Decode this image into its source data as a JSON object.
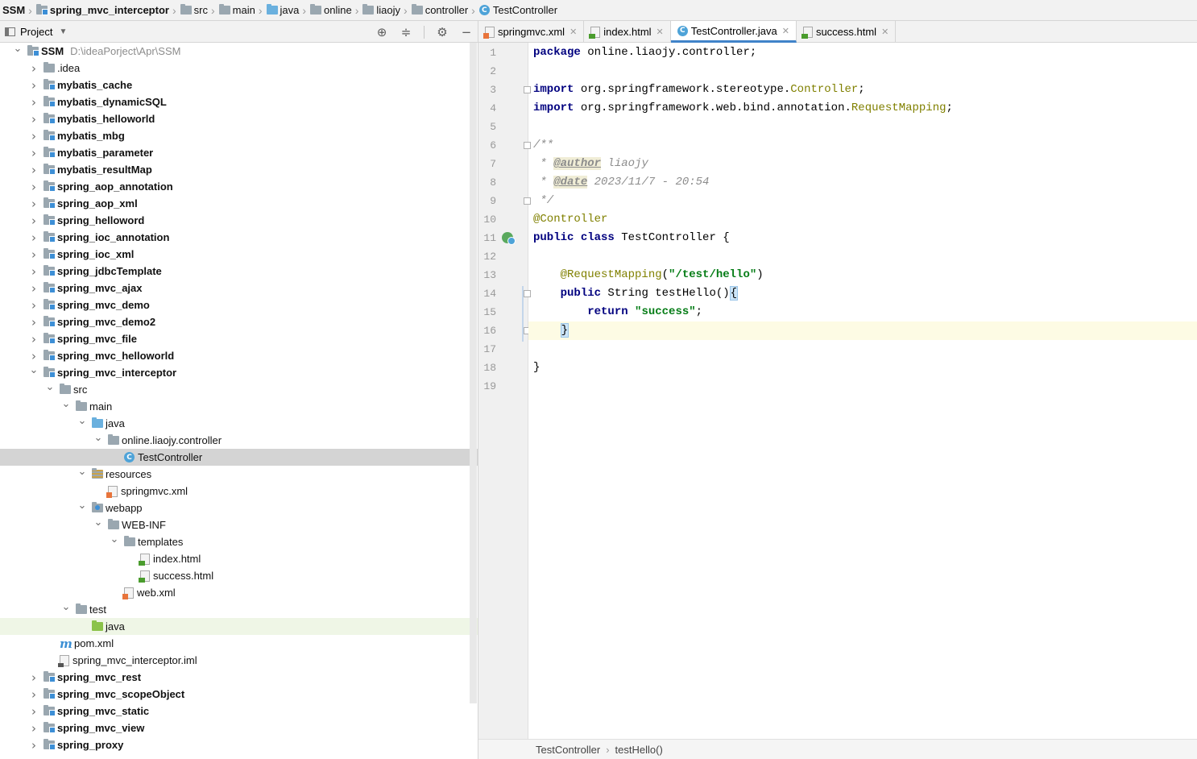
{
  "breadcrumbs": [
    {
      "label": "SSM",
      "icon": "none",
      "bold": true
    },
    {
      "label": "spring_mvc_interceptor",
      "icon": "module-folder",
      "bold": true
    },
    {
      "label": "src",
      "icon": "folder",
      "bold": false
    },
    {
      "label": "main",
      "icon": "folder",
      "bold": false
    },
    {
      "label": "java",
      "icon": "source-folder",
      "bold": false
    },
    {
      "label": "online",
      "icon": "package",
      "bold": false
    },
    {
      "label": "liaojy",
      "icon": "package",
      "bold": false
    },
    {
      "label": "controller",
      "icon": "package",
      "bold": false
    },
    {
      "label": "TestController",
      "icon": "class",
      "bold": false
    }
  ],
  "project_panel": {
    "title": "Project",
    "tools": [
      "locate-icon",
      "collapse-all-icon",
      "gear-icon",
      "minimize-icon"
    ]
  },
  "tree": [
    {
      "label": "SSM",
      "path": "D:\\ideaPorject\\Apr\\SSM",
      "depth": 0,
      "state": "open",
      "icon": "module",
      "bold": true
    },
    {
      "label": ".idea",
      "depth": 1,
      "state": "closed",
      "icon": "folder"
    },
    {
      "label": "mybatis_cache",
      "depth": 1,
      "state": "closed",
      "icon": "module",
      "bold": true
    },
    {
      "label": "mybatis_dynamicSQL",
      "depth": 1,
      "state": "closed",
      "icon": "module",
      "bold": true
    },
    {
      "label": "mybatis_helloworld",
      "depth": 1,
      "state": "closed",
      "icon": "module",
      "bold": true
    },
    {
      "label": "mybatis_mbg",
      "depth": 1,
      "state": "closed",
      "icon": "module",
      "bold": true
    },
    {
      "label": "mybatis_parameter",
      "depth": 1,
      "state": "closed",
      "icon": "module",
      "bold": true
    },
    {
      "label": "mybatis_resultMap",
      "depth": 1,
      "state": "closed",
      "icon": "module",
      "bold": true
    },
    {
      "label": "spring_aop_annotation",
      "depth": 1,
      "state": "closed",
      "icon": "module",
      "bold": true
    },
    {
      "label": "spring_aop_xml",
      "depth": 1,
      "state": "closed",
      "icon": "module",
      "bold": true
    },
    {
      "label": "spring_helloword",
      "depth": 1,
      "state": "closed",
      "icon": "module",
      "bold": true
    },
    {
      "label": "spring_ioc_annotation",
      "depth": 1,
      "state": "closed",
      "icon": "module",
      "bold": true
    },
    {
      "label": "spring_ioc_xml",
      "depth": 1,
      "state": "closed",
      "icon": "module",
      "bold": true
    },
    {
      "label": "spring_jdbcTemplate",
      "depth": 1,
      "state": "closed",
      "icon": "module",
      "bold": true
    },
    {
      "label": "spring_mvc_ajax",
      "depth": 1,
      "state": "closed",
      "icon": "module",
      "bold": true
    },
    {
      "label": "spring_mvc_demo",
      "depth": 1,
      "state": "closed",
      "icon": "module",
      "bold": true
    },
    {
      "label": "spring_mvc_demo2",
      "depth": 1,
      "state": "closed",
      "icon": "module",
      "bold": true
    },
    {
      "label": "spring_mvc_file",
      "depth": 1,
      "state": "closed",
      "icon": "module",
      "bold": true
    },
    {
      "label": "spring_mvc_helloworld",
      "depth": 1,
      "state": "closed",
      "icon": "module",
      "bold": true
    },
    {
      "label": "spring_mvc_interceptor",
      "depth": 1,
      "state": "open",
      "icon": "module",
      "bold": true
    },
    {
      "label": "src",
      "depth": 2,
      "state": "open",
      "icon": "folder"
    },
    {
      "label": "main",
      "depth": 3,
      "state": "open",
      "icon": "folder"
    },
    {
      "label": "java",
      "depth": 4,
      "state": "open",
      "icon": "source-folder"
    },
    {
      "label": "online.liaojy.controller",
      "depth": 5,
      "state": "open",
      "icon": "package"
    },
    {
      "label": "TestController",
      "depth": 6,
      "state": "leaf",
      "icon": "class",
      "selected": true
    },
    {
      "label": "resources",
      "depth": 4,
      "state": "open",
      "icon": "resources-folder"
    },
    {
      "label": "springmvc.xml",
      "depth": 5,
      "state": "leaf",
      "icon": "xml-file"
    },
    {
      "label": "webapp",
      "depth": 4,
      "state": "open",
      "icon": "web-folder"
    },
    {
      "label": "WEB-INF",
      "depth": 5,
      "state": "open",
      "icon": "folder"
    },
    {
      "label": "templates",
      "depth": 6,
      "state": "open",
      "icon": "folder"
    },
    {
      "label": "index.html",
      "depth": 7,
      "state": "leaf",
      "icon": "html-file"
    },
    {
      "label": "success.html",
      "depth": 7,
      "state": "leaf",
      "icon": "html-file"
    },
    {
      "label": "web.xml",
      "depth": 6,
      "state": "leaf",
      "icon": "xml-file"
    },
    {
      "label": "test",
      "depth": 3,
      "state": "open",
      "icon": "folder"
    },
    {
      "label": "java",
      "depth": 4,
      "state": "leaf",
      "icon": "test-folder",
      "highlight": true
    },
    {
      "label": "pom.xml",
      "depth": 2,
      "state": "leaf",
      "icon": "maven-file"
    },
    {
      "label": "spring_mvc_interceptor.iml",
      "depth": 2,
      "state": "leaf",
      "icon": "iml-file"
    },
    {
      "label": "spring_mvc_rest",
      "depth": 1,
      "state": "closed",
      "icon": "module",
      "bold": true
    },
    {
      "label": "spring_mvc_scopeObject",
      "depth": 1,
      "state": "closed",
      "icon": "module",
      "bold": true
    },
    {
      "label": "spring_mvc_static",
      "depth": 1,
      "state": "closed",
      "icon": "module",
      "bold": true
    },
    {
      "label": "spring_mvc_view",
      "depth": 1,
      "state": "closed",
      "icon": "module",
      "bold": true
    },
    {
      "label": "spring_proxy",
      "depth": 1,
      "state": "closed",
      "icon": "module",
      "bold": true
    }
  ],
  "tabs": [
    {
      "label": "springmvc.xml",
      "icon": "xml-file",
      "active": false
    },
    {
      "label": "index.html",
      "icon": "html-file",
      "active": false
    },
    {
      "label": "TestController.java",
      "icon": "class",
      "active": true
    },
    {
      "label": "success.html",
      "icon": "html-file",
      "active": false
    }
  ],
  "editor": {
    "caret_line": 16,
    "lines": [
      [
        {
          "t": "package",
          "c": "kw"
        },
        {
          "t": " online.liaojy.controller;"
        }
      ],
      [],
      [
        {
          "t": "import",
          "c": "kw"
        },
        {
          "t": " org.springframework.stereotype."
        },
        {
          "t": "Controller",
          "c": "ann"
        },
        {
          "t": ";"
        }
      ],
      [
        {
          "t": "import",
          "c": "kw"
        },
        {
          "t": " org.springframework.web.bind.annotation."
        },
        {
          "t": "RequestMapping",
          "c": "ann"
        },
        {
          "t": ";"
        }
      ],
      [],
      [
        {
          "t": "/**",
          "c": "cmt"
        }
      ],
      [
        {
          "t": " * ",
          "c": "cmt"
        },
        {
          "t": "@author",
          "c": "doctag"
        },
        {
          "t": " liaojy",
          "c": "cmt"
        }
      ],
      [
        {
          "t": " * ",
          "c": "cmt"
        },
        {
          "t": "@date",
          "c": "doctag"
        },
        {
          "t": " 2023/11/7 - 20:54",
          "c": "cmt"
        }
      ],
      [
        {
          "t": " */",
          "c": "cmt"
        }
      ],
      [
        {
          "t": "@Controller",
          "c": "ann"
        }
      ],
      [
        {
          "t": "public",
          "c": "kw"
        },
        {
          "t": " "
        },
        {
          "t": "class",
          "c": "kw"
        },
        {
          "t": " TestController {"
        }
      ],
      [],
      [
        {
          "t": "    "
        },
        {
          "t": "@RequestMapping",
          "c": "ann"
        },
        {
          "t": "("
        },
        {
          "t": "\"/test/hello\"",
          "c": "str"
        },
        {
          "t": ")"
        }
      ],
      [
        {
          "t": "    "
        },
        {
          "t": "public",
          "c": "kw"
        },
        {
          "t": " String testHello()"
        },
        {
          "t": "{",
          "c": "brace-hl"
        }
      ],
      [
        {
          "t": "        "
        },
        {
          "t": "return",
          "c": "kw"
        },
        {
          "t": " "
        },
        {
          "t": "\"success\"",
          "c": "str"
        },
        {
          "t": ";"
        }
      ],
      [
        {
          "t": "    "
        },
        {
          "t": "}",
          "c": "brace-hl"
        }
      ],
      [],
      [
        {
          "t": "}"
        }
      ],
      []
    ]
  },
  "editor_breadcrumb": [
    "TestController",
    "testHello()"
  ]
}
